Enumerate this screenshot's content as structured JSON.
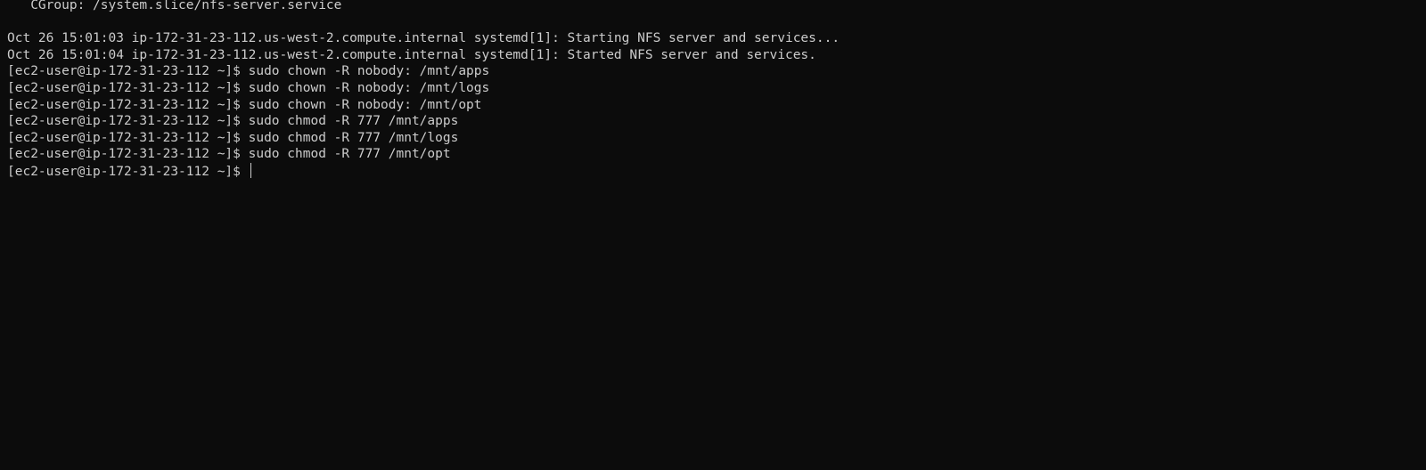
{
  "terminal": {
    "cgroup_line": "   CGroup: /system.slice/nfs-server.service",
    "blank_line": "",
    "log_lines": [
      "Oct 26 15:01:03 ip-172-31-23-112.us-west-2.compute.internal systemd[1]: Starting NFS server and services...",
      "Oct 26 15:01:04 ip-172-31-23-112.us-west-2.compute.internal systemd[1]: Started NFS server and services."
    ],
    "commands": [
      "[ec2-user@ip-172-31-23-112 ~]$ sudo chown -R nobody: /mnt/apps",
      "[ec2-user@ip-172-31-23-112 ~]$ sudo chown -R nobody: /mnt/logs",
      "[ec2-user@ip-172-31-23-112 ~]$ sudo chown -R nobody: /mnt/opt",
      "[ec2-user@ip-172-31-23-112 ~]$ sudo chmod -R 777 /mnt/apps",
      "[ec2-user@ip-172-31-23-112 ~]$ sudo chmod -R 777 /mnt/logs",
      "[ec2-user@ip-172-31-23-112 ~]$ sudo chmod -R 777 /mnt/opt"
    ],
    "prompt": "[ec2-user@ip-172-31-23-112 ~]$ ",
    "colors": {
      "background": "#0c0c0c",
      "foreground": "#cccccc"
    }
  }
}
